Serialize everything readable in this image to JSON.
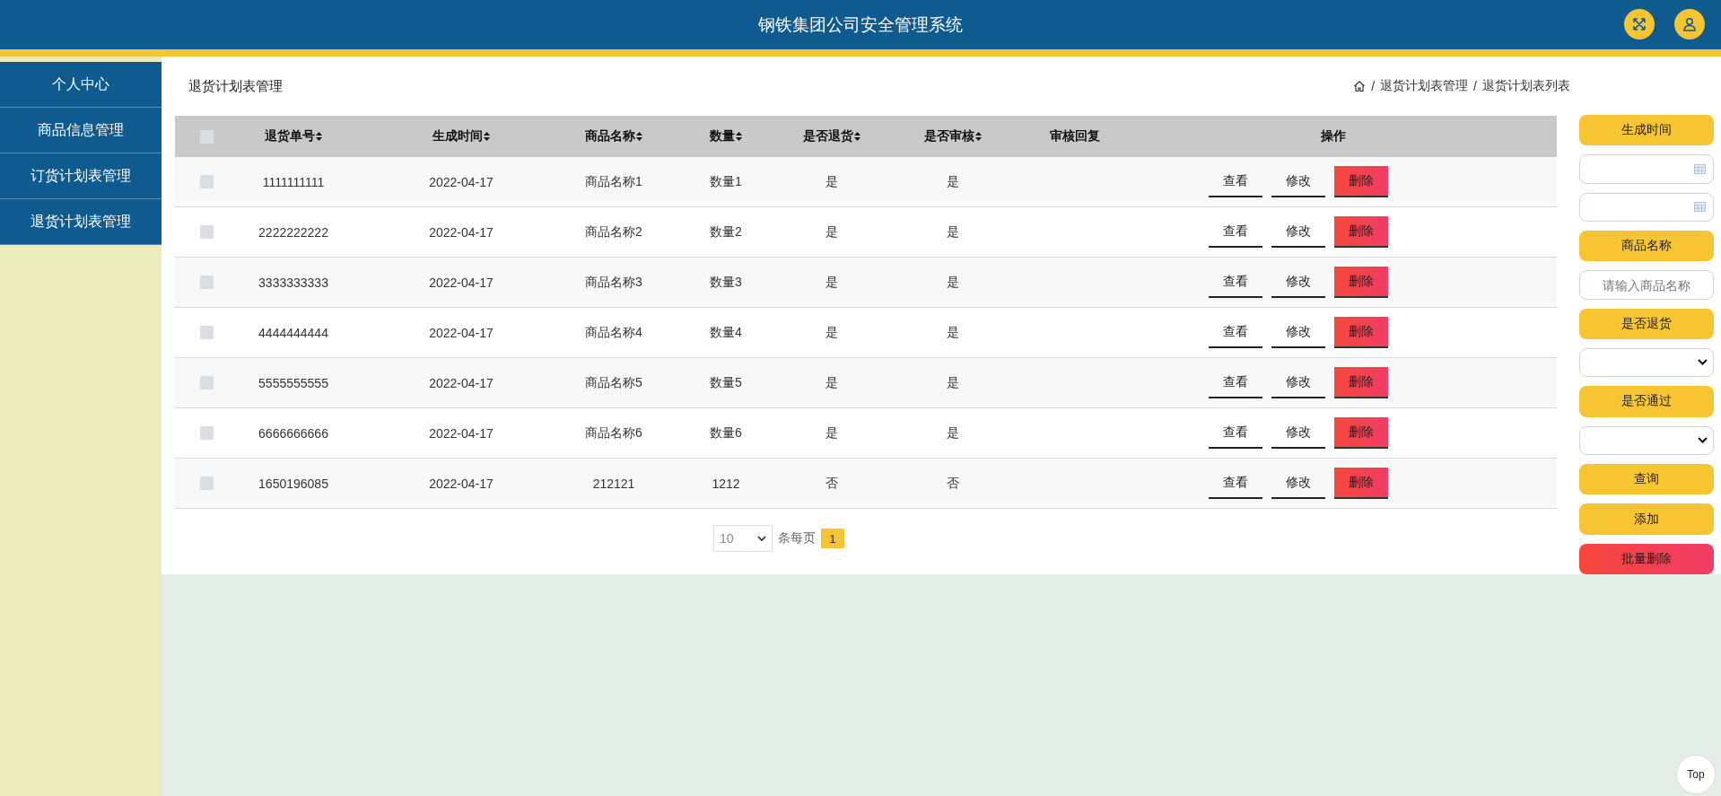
{
  "header": {
    "title": "钢铁集团公司安全管理系统"
  },
  "sidebar": {
    "items": [
      {
        "label": "个人中心"
      },
      {
        "label": "商品信息管理"
      },
      {
        "label": "订货计划表管理"
      },
      {
        "label": "退货计划表管理"
      }
    ]
  },
  "page_title": "退货计划表管理",
  "breadcrumb": [
    {
      "separator": "/",
      "label": "退货计划表管理"
    },
    {
      "separator": "/",
      "label": "退货计划表列表"
    }
  ],
  "table": {
    "select_all_checked": false,
    "columns": [
      {
        "label": "退货单号",
        "sortable": true
      },
      {
        "label": "生成时间",
        "sortable": true
      },
      {
        "label": "商品名称",
        "sortable": true
      },
      {
        "label": "数量",
        "sortable": true
      },
      {
        "label": "是否退货",
        "sortable": true
      },
      {
        "label": "是否审核",
        "sortable": true
      },
      {
        "label": "审核回复",
        "sortable": false
      },
      {
        "label": "操作",
        "sortable": false
      }
    ],
    "rows": [
      {
        "checked": false,
        "cells": [
          "1111111111",
          "2022-04-17",
          "商品名称1",
          "数量1",
          "是",
          "是",
          ""
        ],
        "actions": [
          "查看",
          "修改",
          "删除"
        ]
      },
      {
        "checked": false,
        "cells": [
          "2222222222",
          "2022-04-17",
          "商品名称2",
          "数量2",
          "是",
          "是",
          ""
        ],
        "actions": [
          "查看",
          "修改",
          "删除"
        ]
      },
      {
        "checked": false,
        "cells": [
          "3333333333",
          "2022-04-17",
          "商品名称3",
          "数量3",
          "是",
          "是",
          ""
        ],
        "actions": [
          "查看",
          "修改",
          "删除"
        ]
      },
      {
        "checked": false,
        "cells": [
          "4444444444",
          "2022-04-17",
          "商品名称4",
          "数量4",
          "是",
          "是",
          ""
        ],
        "actions": [
          "查看",
          "修改",
          "删除"
        ]
      },
      {
        "checked": false,
        "cells": [
          "5555555555",
          "2022-04-17",
          "商品名称5",
          "数量5",
          "是",
          "是",
          ""
        ],
        "actions": [
          "查看",
          "修改",
          "删除"
        ]
      },
      {
        "checked": false,
        "cells": [
          "6666666666",
          "2022-04-17",
          "商品名称6",
          "数量6",
          "是",
          "是",
          ""
        ],
        "actions": [
          "查看",
          "修改",
          "删除"
        ]
      },
      {
        "checked": false,
        "cells": [
          "1650196085",
          "2022-04-17",
          "212121",
          "1212",
          "否",
          "否",
          ""
        ],
        "actions": [
          "查看",
          "修改",
          "删除"
        ]
      }
    ]
  },
  "pagination": {
    "page_size": "10",
    "page_size_label": "条每页",
    "current_page": "1"
  },
  "filters": [
    {
      "kind": "label",
      "text": "生成时间"
    },
    {
      "kind": "date"
    },
    {
      "kind": "date"
    },
    {
      "kind": "label",
      "text": "商品名称"
    },
    {
      "kind": "input",
      "placeholder": "请输入商品名称"
    },
    {
      "kind": "label",
      "text": "是否退货"
    },
    {
      "kind": "select"
    },
    {
      "kind": "label",
      "text": "是否通过"
    },
    {
      "kind": "select"
    },
    {
      "kind": "button",
      "text": "查询"
    },
    {
      "kind": "button",
      "text": "添加"
    },
    {
      "kind": "danger",
      "text": "批量删除"
    }
  ],
  "back_to_top": "Top"
}
